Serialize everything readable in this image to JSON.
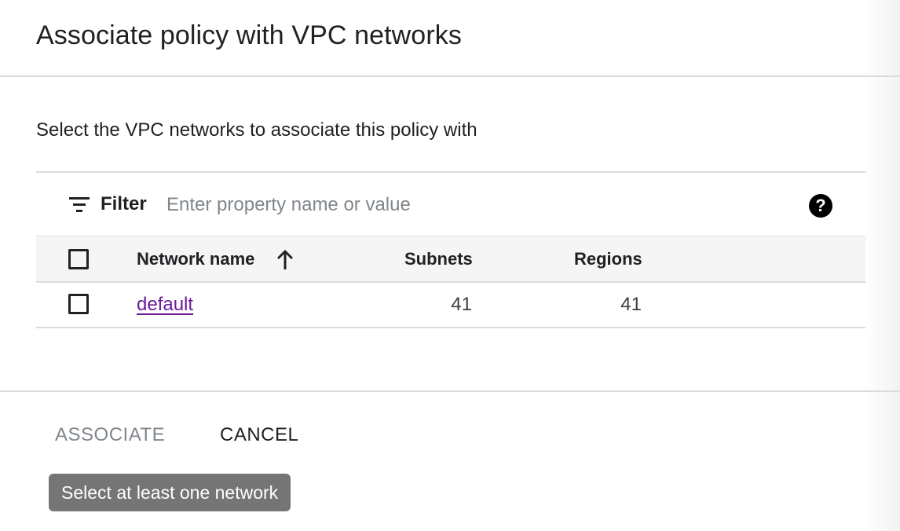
{
  "dialog": {
    "title": "Associate policy with VPC networks",
    "instruction": "Select the VPC networks to associate this policy with"
  },
  "filter": {
    "icon": "filter-list-icon",
    "label": "Filter",
    "placeholder": "Enter property name or value",
    "value": "",
    "help_icon": "help-circle-icon",
    "help_glyph": "?"
  },
  "table": {
    "columns": {
      "name": "Network name",
      "subnets": "Subnets",
      "regions": "Regions"
    },
    "sort": {
      "column": "name",
      "direction": "ascending",
      "icon": "arrow-up-icon"
    },
    "rows": [
      {
        "name": "default",
        "subnets": "41",
        "regions": "41",
        "checked": false
      }
    ]
  },
  "actions": {
    "associate_label": "ASSOCIATE",
    "associate_enabled": false,
    "cancel_label": "CANCEL"
  },
  "tooltip": {
    "text": "Select at least one network"
  },
  "colors": {
    "link": "#6a1b9a",
    "disabled_text": "#80868b",
    "tooltip_bg": "#757575",
    "divider": "#dadce0",
    "header_bg": "#f5f5f5"
  }
}
